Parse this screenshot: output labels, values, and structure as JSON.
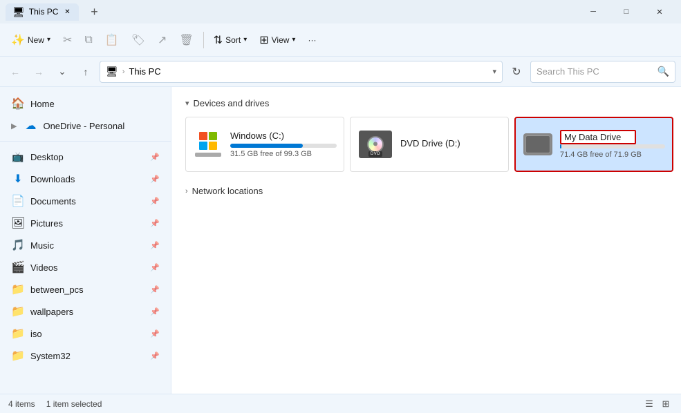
{
  "window": {
    "title": "This PC",
    "tab_label": "This PC"
  },
  "toolbar": {
    "new_label": "New",
    "sort_label": "Sort",
    "view_label": "View",
    "more_label": "···"
  },
  "address_bar": {
    "path_icon": "🖥",
    "path_root": "This PC",
    "placeholder": "Search This PC"
  },
  "sidebar": {
    "items": [
      {
        "label": "Home",
        "icon": "🏠",
        "pinned": false
      },
      {
        "label": "OneDrive - Personal",
        "icon": "☁",
        "pinned": false
      },
      {
        "label": "Desktop",
        "icon": "🟦",
        "pinned": true
      },
      {
        "label": "Downloads",
        "icon": "⬇",
        "pinned": true
      },
      {
        "label": "Documents",
        "icon": "📄",
        "pinned": true
      },
      {
        "label": "Pictures",
        "icon": "🖼",
        "pinned": true
      },
      {
        "label": "Music",
        "icon": "🎵",
        "pinned": true
      },
      {
        "label": "Videos",
        "icon": "🎬",
        "pinned": true
      },
      {
        "label": "between_pcs",
        "icon": "📁",
        "pinned": true
      },
      {
        "label": "wallpapers",
        "icon": "📁",
        "pinned": true
      },
      {
        "label": "iso",
        "icon": "📁",
        "pinned": true
      },
      {
        "label": "System32",
        "icon": "📁",
        "pinned": true
      }
    ]
  },
  "sections": {
    "devices_drives": {
      "label": "Devices and drives",
      "drives": [
        {
          "name": "Windows (C:)",
          "free": "31.5 GB free of 99.3 GB",
          "used_pct": 68,
          "type": "windows",
          "selected": false
        },
        {
          "name": "DVD Drive (D:)",
          "free": "",
          "used_pct": 0,
          "type": "dvd",
          "selected": false
        },
        {
          "name": "My Data Drive",
          "free": "71.4 GB free of 71.9 GB",
          "used_pct": 1,
          "type": "hdd",
          "selected": true,
          "renaming": true
        }
      ]
    },
    "network_locations": {
      "label": "Network locations"
    }
  },
  "status_bar": {
    "items_count": "4 items",
    "selected_info": "1 item selected"
  }
}
